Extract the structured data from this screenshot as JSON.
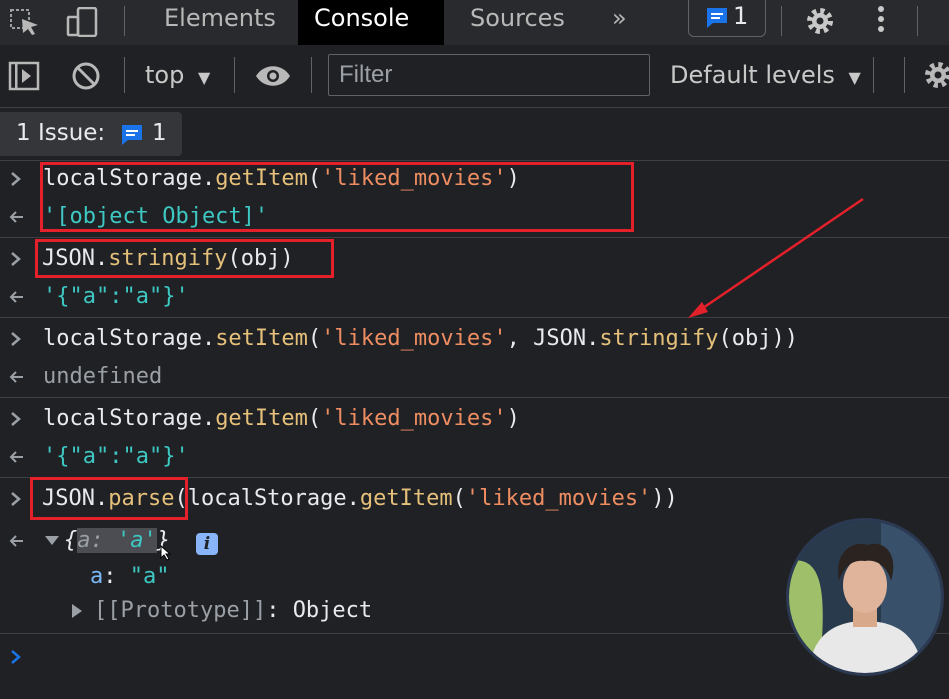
{
  "tabs": {
    "elements": "Elements",
    "console": "Console",
    "sources": "Sources",
    "more": "»",
    "issues_count": "1"
  },
  "toolbar": {
    "context": "top",
    "filter_placeholder": "Filter",
    "levels": "Default levels"
  },
  "issues_bar": {
    "label": "1 Issue:",
    "count": "1"
  },
  "console": {
    "entries": [
      {
        "type": "input",
        "parts": [
          "localStorage.",
          "getItem",
          "(",
          "'liked_movies'",
          ")"
        ]
      },
      {
        "type": "result",
        "text": "'[object Object]'"
      },
      {
        "type": "input",
        "parts": [
          "JSON.",
          "stringify",
          "(obj)"
        ]
      },
      {
        "type": "result",
        "text": "'{\"a\":\"a\"}'"
      },
      {
        "type": "input",
        "parts": [
          "localStorage.",
          "setItem",
          "(",
          "'liked_movies'",
          ", JSON.",
          "stringify",
          "(obj))"
        ]
      },
      {
        "type": "result",
        "text": "undefined"
      },
      {
        "type": "input",
        "parts": [
          "localStorage.",
          "getItem",
          "(",
          "'liked_movies'",
          ")"
        ]
      },
      {
        "type": "result",
        "text": "'{\"a\":\"a\"}'"
      },
      {
        "type": "input",
        "parts": [
          "JSON.",
          "parse",
          "(localStorage.",
          "getItem",
          "(",
          "'liked_movies'",
          "))"
        ]
      }
    ],
    "object_preview": {
      "open": "{",
      "key": "a:",
      "value": "'a'",
      "close": "}",
      "info": "i"
    },
    "object_property": {
      "key": "a",
      "sep": ": ",
      "value": "\"a\""
    },
    "prototype": {
      "label": "[[Prototype]]",
      "sep": ": ",
      "value": "Object"
    }
  },
  "colors": {
    "background": "#202124",
    "annotation_red": "#e4202a",
    "function": "#e5c07b",
    "string": "#ef8d62",
    "result_string": "#3ec8c3",
    "accent_blue": "#1a73e8"
  }
}
